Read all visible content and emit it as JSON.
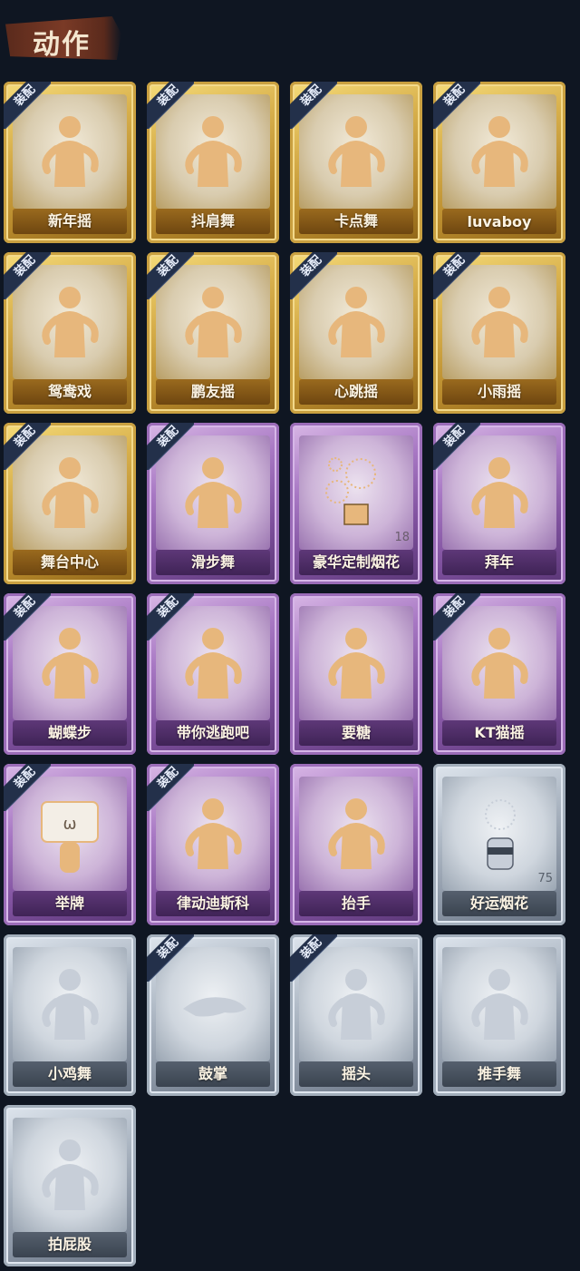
{
  "section_title": "动作",
  "badge_label": "装配",
  "colors": {
    "gold": "#d8b04c",
    "purple": "#a878c4",
    "silver": "#b2bcc8",
    "background": "#0f1622",
    "figure_gold": "#e7b77c",
    "figure_silver": "#c7ced8"
  },
  "cards": [
    {
      "name": "新年摇",
      "rarity": "gold",
      "equipped": true,
      "icon": "figure-hands-up-icon"
    },
    {
      "name": "抖肩舞",
      "rarity": "gold",
      "equipped": true,
      "icon": "figure-shrug-icon"
    },
    {
      "name": "卡点舞",
      "rarity": "gold",
      "equipped": true,
      "icon": "figure-point-up-icon"
    },
    {
      "name": "luvaboy",
      "rarity": "gold",
      "equipped": true,
      "icon": "figure-cross-arms-icon"
    },
    {
      "name": "鸳鸯戏",
      "rarity": "gold",
      "equipped": true,
      "icon": "figure-arms-out-icon"
    },
    {
      "name": "鹏友摇",
      "rarity": "gold",
      "equipped": true,
      "icon": "figure-wave-icon"
    },
    {
      "name": "心跳摇",
      "rarity": "gold",
      "equipped": true,
      "icon": "figure-heartbeat-icon"
    },
    {
      "name": "小雨摇",
      "rarity": "gold",
      "equipped": true,
      "icon": "figure-rain-icon"
    },
    {
      "name": "舞台中心",
      "rarity": "gold",
      "equipped": true,
      "icon": "figure-center-stage-icon"
    },
    {
      "name": "滑步舞",
      "rarity": "purple",
      "equipped": true,
      "icon": "figure-slide-icon"
    },
    {
      "name": "豪华定制烟花",
      "rarity": "purple",
      "equipped": false,
      "icon": "fireworks-box-icon",
      "count": "18"
    },
    {
      "name": "拜年",
      "rarity": "purple",
      "equipped": true,
      "icon": "figure-bow-icon"
    },
    {
      "name": "蝴蝶步",
      "rarity": "purple",
      "equipped": true,
      "icon": "figure-butterfly-icon"
    },
    {
      "name": "带你逃跑吧",
      "rarity": "purple",
      "equipped": true,
      "icon": "figure-run-icon"
    },
    {
      "name": "要糖",
      "rarity": "purple",
      "equipped": false,
      "icon": "figure-reach-icon"
    },
    {
      "name": "KT猫摇",
      "rarity": "purple",
      "equipped": true,
      "icon": "figure-cat-dance-icon"
    },
    {
      "name": "举牌",
      "rarity": "purple",
      "equipped": true,
      "icon": "sign-board-icon"
    },
    {
      "name": "律动迪斯科",
      "rarity": "purple",
      "equipped": true,
      "icon": "figure-disco-icon"
    },
    {
      "name": "抬手",
      "rarity": "purple",
      "equipped": false,
      "icon": "figure-raise-hand-icon"
    },
    {
      "name": "好运烟花",
      "rarity": "silver",
      "equipped": false,
      "icon": "firework-can-icon",
      "count": "75"
    },
    {
      "name": "小鸡舞",
      "rarity": "silver",
      "equipped": false,
      "icon": "figure-chicken-icon"
    },
    {
      "name": "鼓掌",
      "rarity": "silver",
      "equipped": true,
      "icon": "clap-hands-icon"
    },
    {
      "name": "摇头",
      "rarity": "silver",
      "equipped": true,
      "icon": "figure-shake-head-icon"
    },
    {
      "name": "推手舞",
      "rarity": "silver",
      "equipped": false,
      "icon": "figure-push-hands-icon"
    },
    {
      "name": "拍屁股",
      "rarity": "silver",
      "equipped": false,
      "icon": "figure-slap-icon"
    }
  ]
}
